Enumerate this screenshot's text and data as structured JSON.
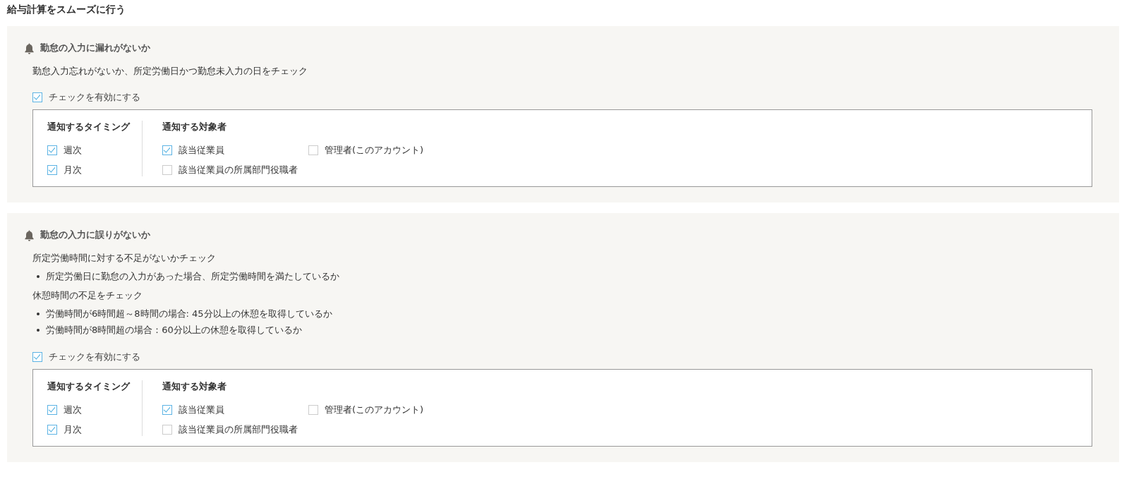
{
  "page_title": "給与計算をスムーズに行う",
  "sections": [
    {
      "title": "勤怠の入力に漏れがないか",
      "description": [
        {
          "text": "勤怠入力忘れがないか、所定労働日かつ勤怠未入力の日をチェック"
        }
      ],
      "enable": {
        "label": "チェックを有効にする",
        "checked": true
      },
      "timing": {
        "heading": "通知するタイミング",
        "options": [
          {
            "label": "週次",
            "checked": true
          },
          {
            "label": "月次",
            "checked": true
          }
        ]
      },
      "recipients": {
        "heading": "通知する対象者",
        "options": [
          {
            "label": "該当従業員",
            "checked": true
          },
          {
            "label": "管理者(このアカウント)",
            "checked": false
          },
          {
            "label": "該当従業員の所属部門役職者",
            "checked": false
          }
        ]
      }
    },
    {
      "title": "勤怠の入力に誤りがないか",
      "description": [
        {
          "text": "所定労働時間に対する不足がないかチェック",
          "bullets": [
            "所定労働日に勤怠の入力があった場合、所定労働時間を満たしているか"
          ]
        },
        {
          "text": "休憩時間の不足をチェック",
          "bullets": [
            "労働時間が6時間超～8時間の場合: 45分以上の休憩を取得しているか",
            "労働時間が8時間超の場合：60分以上の休憩を取得しているか"
          ]
        }
      ],
      "enable": {
        "label": "チェックを有効にする",
        "checked": true
      },
      "timing": {
        "heading": "通知するタイミング",
        "options": [
          {
            "label": "週次",
            "checked": true
          },
          {
            "label": "月次",
            "checked": true
          }
        ]
      },
      "recipients": {
        "heading": "通知する対象者",
        "options": [
          {
            "label": "該当従業員",
            "checked": true
          },
          {
            "label": "管理者(このアカウント)",
            "checked": false
          },
          {
            "label": "該当従業員の所属部門役職者",
            "checked": false
          }
        ]
      }
    }
  ]
}
